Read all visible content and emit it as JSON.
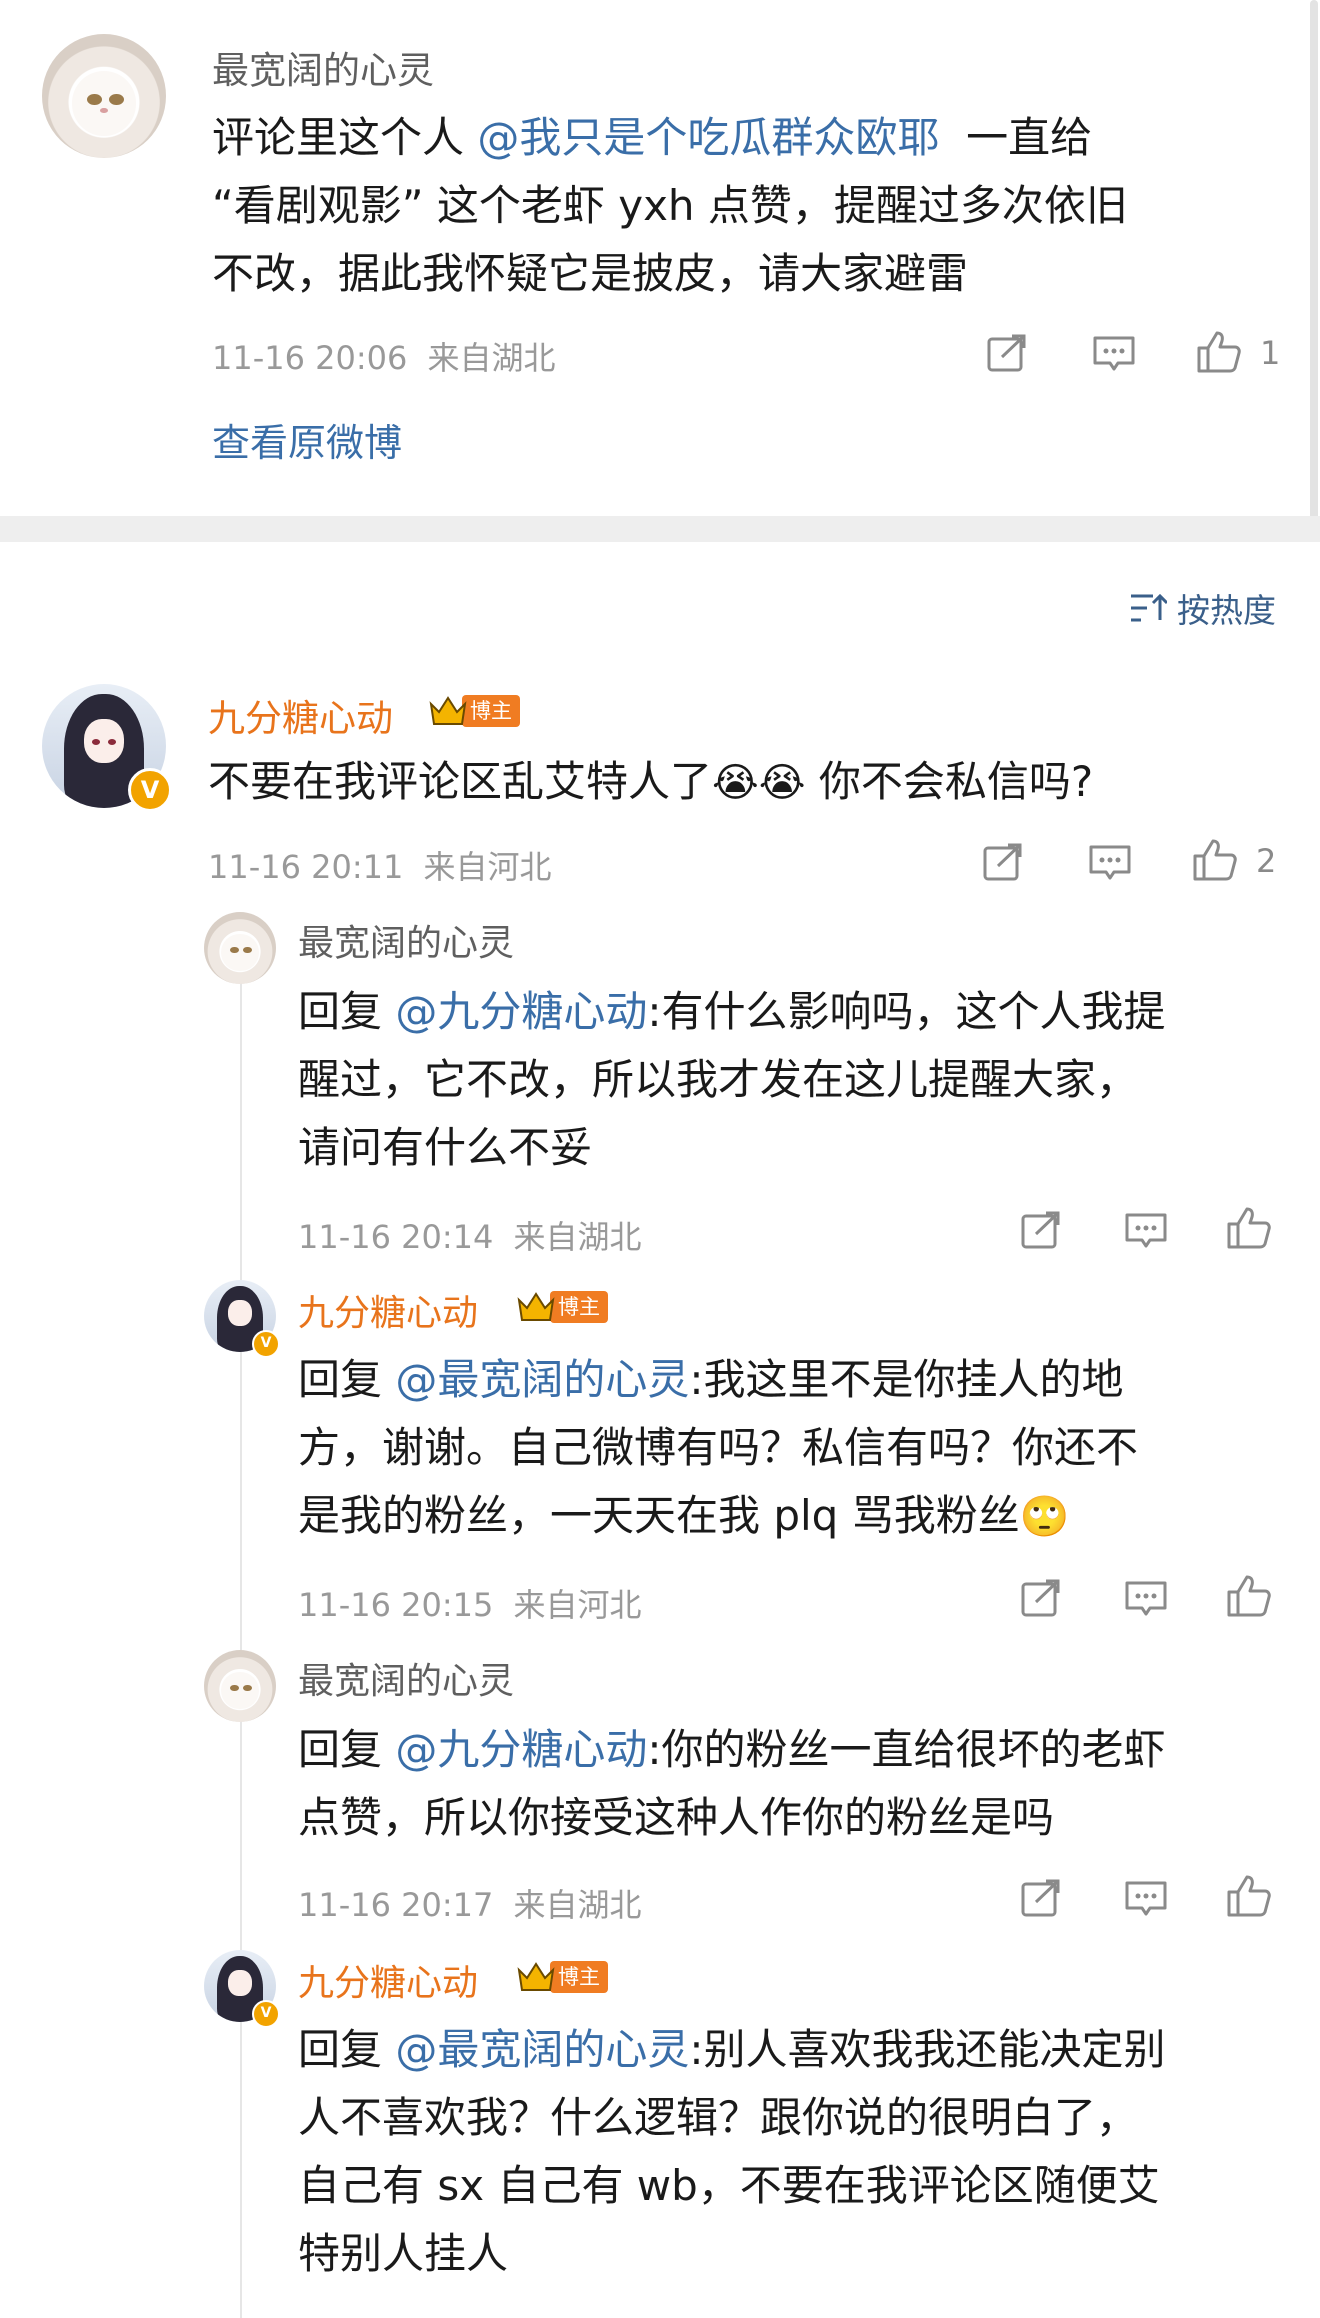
{
  "original_post": {
    "author": "最宽阔的心灵",
    "text_lines": [
      "评论里这个人 ",
      "“看剧观影” 这个老虾 yxh 点赞，提醒过多次依旧",
      "不改，据此我怀疑它是披皮，请大家避雷"
    ],
    "mention": "@我只是个吃瓜群众欧耶",
    "after_mention": "  一直给",
    "time": "11-16 20:06",
    "location": "来自湖北",
    "likes": "1",
    "view_original": "查看原微博"
  },
  "sort_label": "按热度",
  "main_comment": {
    "author": "九分糖心动",
    "badge": "博主",
    "text": "不要在我评论区乱艾特人了",
    "emoji": "😭😭",
    "text_after": " 你不会私信吗?",
    "time": "11-16 20:11",
    "location": "来自河北",
    "likes": "2"
  },
  "replies": [
    {
      "author": "最宽阔的心灵",
      "reply_prefix": "回复 ",
      "mention": "@九分糖心动",
      "lines": [
        ":有什么影响吗，这个人我提",
        "醒过，它不改，所以我才发在这儿提醒大家，",
        "请问有什么不妥"
      ],
      "time": "11-16 20:14",
      "location": "来自湖北"
    },
    {
      "author": "九分糖心动",
      "badge": "博主",
      "reply_prefix": "回复 ",
      "mention": "@最宽阔的心灵",
      "lines": [
        ":我这里不是你挂人的地",
        "方，谢谢。自己微博有吗？私信有吗？你还不",
        "是我的粉丝，一天天在我 plq 骂我粉丝"
      ],
      "emoji": "🙄",
      "time": "11-16 20:15",
      "location": "来自河北"
    },
    {
      "author": "最宽阔的心灵",
      "reply_prefix": "回复 ",
      "mention": "@九分糖心动",
      "lines": [
        ":你的粉丝一直给很坏的老虾",
        "点赞，所以你接受这种人作你的粉丝是吗"
      ],
      "time": "11-16 20:17",
      "location": "来自湖北"
    },
    {
      "author": "九分糖心动",
      "badge": "博主",
      "reply_prefix": "回复 ",
      "mention": "@最宽阔的心灵",
      "lines": [
        ":别人喜欢我我还能决定别",
        "人不喜欢我？什么逻辑？跟你说的很明白了，",
        "自己有 sx 自己有 wb，不要在我评论区随便艾",
        "特别人挂人"
      ]
    }
  ],
  "colors": {
    "orange_name": "#e8741c",
    "mention_blue": "#3a6ea8",
    "meta_grey": "#999999"
  }
}
